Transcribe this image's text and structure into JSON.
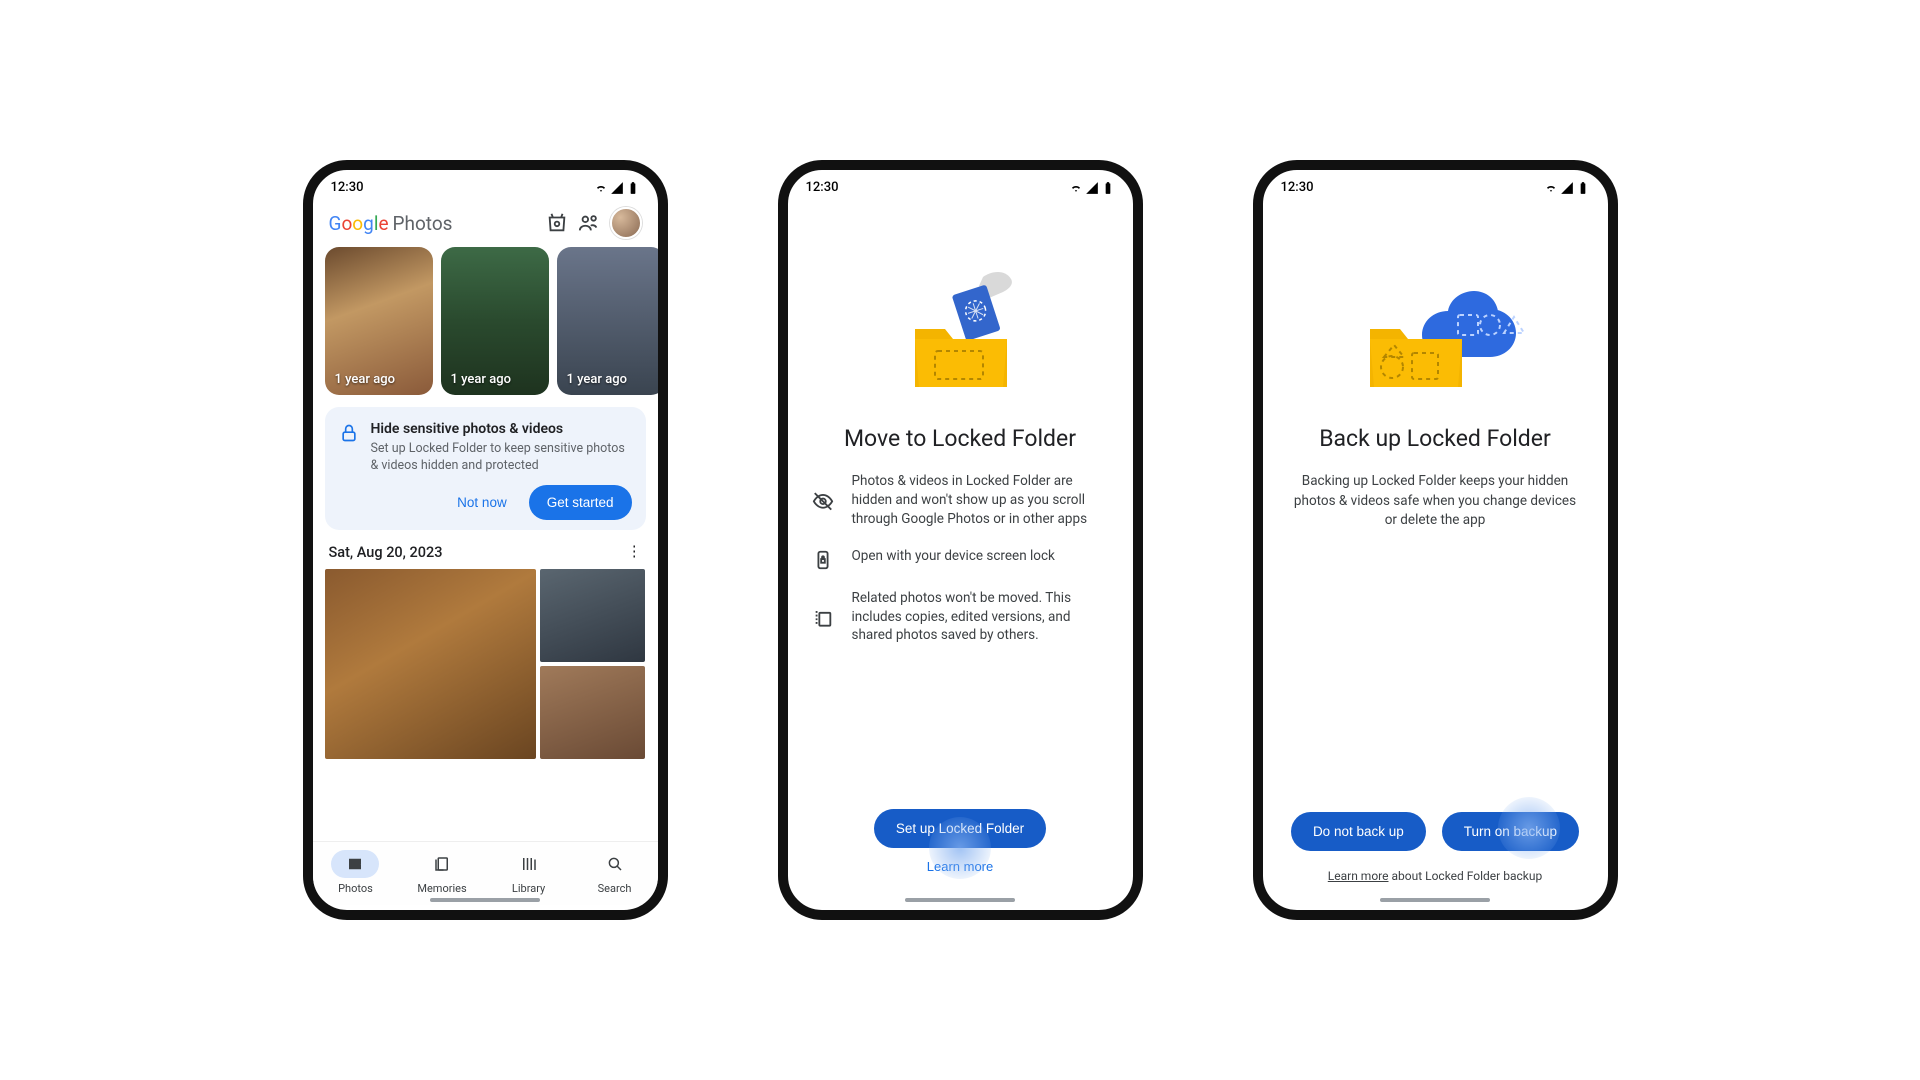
{
  "status": {
    "time": "12:30"
  },
  "phone1": {
    "brand_suffix": "Photos",
    "memories": [
      {
        "label": "1 year ago"
      },
      {
        "label": "1 year ago"
      },
      {
        "label": "1 year ago"
      }
    ],
    "promo": {
      "title": "Hide sensitive photos & videos",
      "body": "Set up Locked Folder to keep sensitive photos & videos hidden and protected",
      "not_now": "Not now",
      "get_started": "Get started"
    },
    "section_date": "Sat, Aug 20, 2023",
    "nav": {
      "photos": "Photos",
      "memories": "Memories",
      "library": "Library",
      "search": "Search"
    }
  },
  "phone2": {
    "title": "Move to Locked Folder",
    "features": [
      {
        "text": "Photos & videos in Locked Folder are hidden and won't show up as you scroll through Google Photos or in other apps"
      },
      {
        "text": "Open with your device screen lock"
      },
      {
        "text": "Related photos won't be moved. This includes copies, edited versions, and shared photos saved by others."
      }
    ],
    "cta_primary": "Set up Locked Folder",
    "cta_secondary": "Learn more"
  },
  "phone3": {
    "title": "Back up Locked Folder",
    "desc": "Backing up Locked Folder keeps your hidden photos & videos safe when you change devices or delete the app",
    "cta_secondary": "Do not back up",
    "cta_primary": "Turn on backup",
    "footnote_link": "Learn more",
    "footnote_rest": " about Locked Folder backup"
  }
}
